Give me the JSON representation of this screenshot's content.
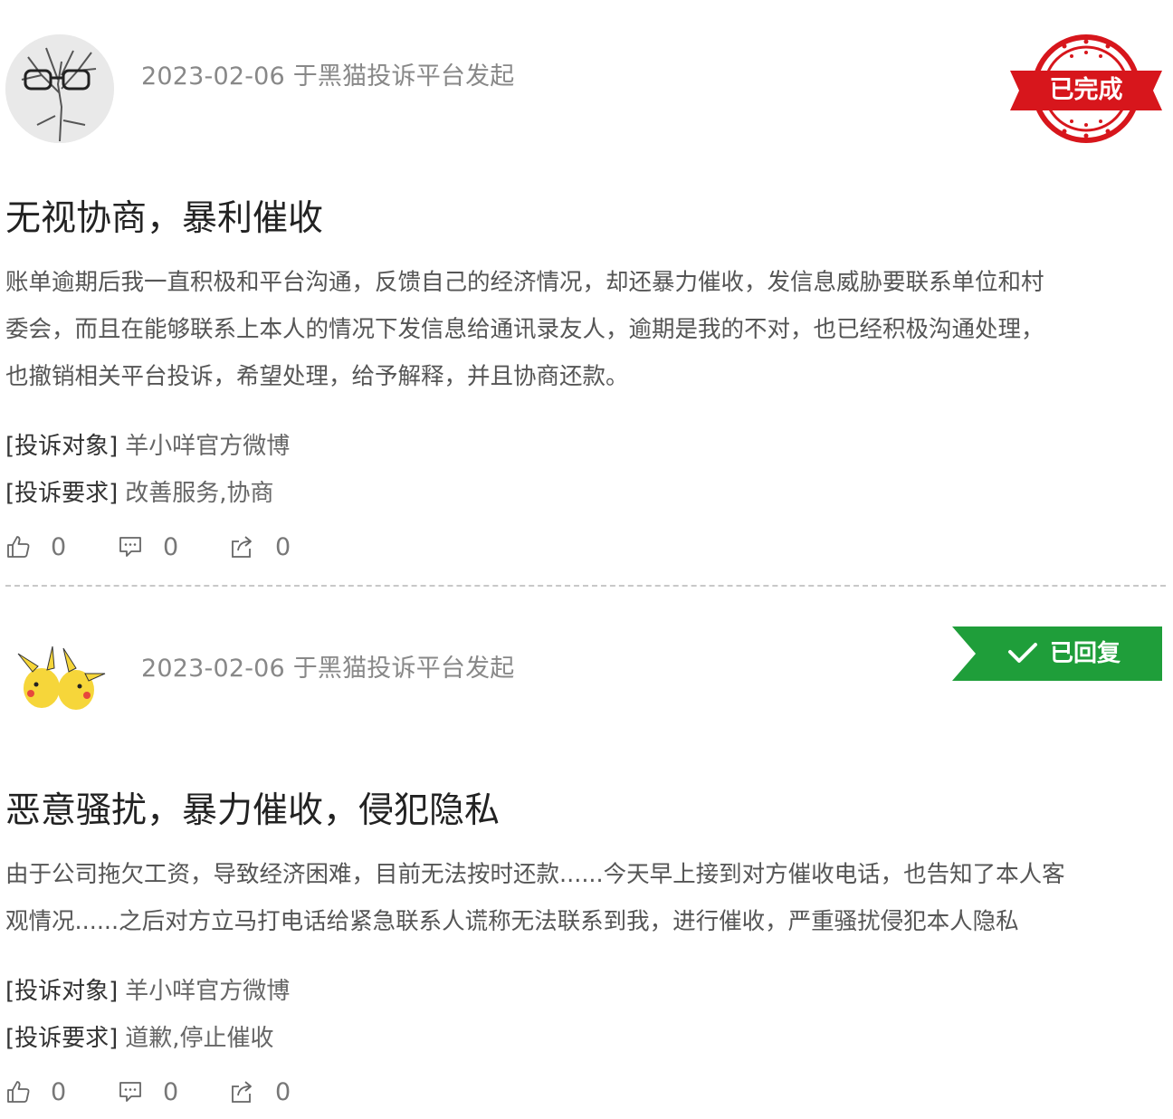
{
  "posts": [
    {
      "date_source": "2023-02-06 于黑猫投诉平台发起",
      "status_label": "已完成",
      "title": "无视协商，暴利催收",
      "content_lines": [
        "账单逾期后我一直积极和平台沟通，反馈自己的经济情况，却还暴力催收，发信息威胁要联系单位和村",
        "委会，而且在能够联系上本人的情况下发信息给通讯录友人，逾期是我的不对，也已经积极沟通处理，",
        "也撤销相关平台投诉，希望处理，给予解释，并且协商还款。"
      ],
      "target_label": "[投诉对象]",
      "target_value": "羊小咩官方微博",
      "request_label": "[投诉要求]",
      "request_value": "改善服务,协商",
      "likes": "0",
      "comments": "0",
      "shares": "0"
    },
    {
      "date_source": "2023-02-06 于黑猫投诉平台发起",
      "status_label": "已回复",
      "title": "恶意骚扰，暴力催收，侵犯隐私",
      "content_lines": [
        "由于公司拖欠工资，导致经济困难，目前无法按时还款......今天早上接到对方催收电话，也告知了本人客",
        "观情况......之后对方立马打电话给紧急联系人谎称无法联系到我，进行催收，严重骚扰侵犯本人隐私"
      ],
      "target_label": "[投诉对象]",
      "target_value": "羊小咩官方微博",
      "request_label": "[投诉要求]",
      "request_value": "道歉,停止催收",
      "likes": "0",
      "comments": "0",
      "shares": "0"
    }
  ],
  "colors": {
    "completed_red": "#d7161c",
    "replied_green": "#1f9e3a",
    "meta_gray": "#888888"
  },
  "icons": [
    "thumbs-up-icon",
    "comment-icon",
    "share-icon",
    "check-icon"
  ]
}
